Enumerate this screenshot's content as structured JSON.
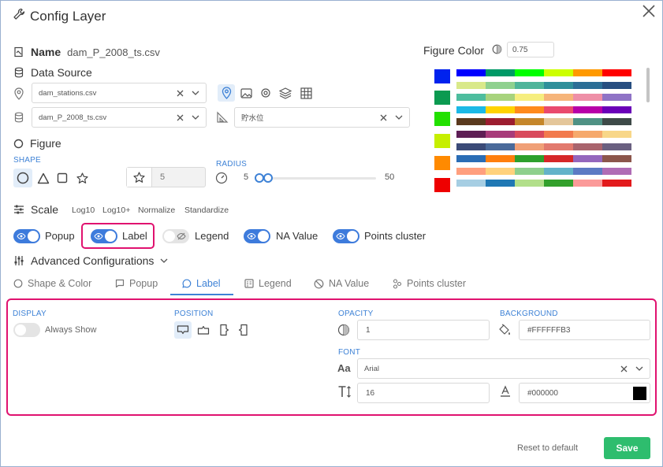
{
  "window": {
    "title": "Config Layer"
  },
  "name": {
    "label": "Name",
    "value": "dam_P_2008_ts.csv"
  },
  "data_source": {
    "label": "Data Source",
    "location_select": "dam_stations.csv",
    "data_select": "dam_P_2008_ts.csv",
    "column_select": "貯水位"
  },
  "figure": {
    "label": "Figure",
    "shape_label": "SHAPE",
    "size_value": "5",
    "radius_label": "RADIUS",
    "radius_min": "5",
    "radius_max": "50"
  },
  "figure_color": {
    "label": "Figure Color",
    "opacity": "0.75",
    "swatches": [
      "#0022ee",
      "#0b9a50",
      "#22e000",
      "#c6ef00",
      "#ff8a00",
      "#ee0000"
    ],
    "palettes": [
      [
        "#0000ff",
        "#009966",
        "#00ff00",
        "#ccff00",
        "#ff9900",
        "#ff0000"
      ],
      [
        "#d9e98a",
        "#8fd18f",
        "#4fb59a",
        "#2f8f9a",
        "#2b6e96",
        "#274e80"
      ],
      [
        "#4dbd9e",
        "#a7d37d",
        "#f6ee7f",
        "#f6b57a",
        "#ee8fa7",
        "#8f73c6"
      ],
      [
        "#1bb9e6",
        "#ffd300",
        "#ff8a1c",
        "#e94a6e",
        "#b700a8",
        "#6a00b8"
      ],
      [
        "#5a3a1e",
        "#9c1d2f",
        "#c5862a",
        "#e4c69a",
        "#4f9184",
        "#3e4a48"
      ],
      [
        "#5e1f55",
        "#a83b7a",
        "#d94a5c",
        "#f27a4d",
        "#f6a96c",
        "#f8d789"
      ],
      [
        "#3b4b78",
        "#4a6a9a",
        "#f0a077",
        "#e27a6e",
        "#a9646d",
        "#6a6080"
      ],
      [
        "#2a6db5",
        "#ff7f0e",
        "#2ca02c",
        "#d62728",
        "#9467bd",
        "#8c564b"
      ],
      [
        "#ff9f7e",
        "#ffd27d",
        "#8ed08d",
        "#63b3c9",
        "#5c7bc4",
        "#b06cb5"
      ],
      [
        "#a6cee3",
        "#1f78b4",
        "#b2df8a",
        "#33a02c",
        "#fb9a99",
        "#e31a1c"
      ]
    ]
  },
  "scale": {
    "label": "Scale",
    "options": [
      "Log10",
      "Log10+",
      "Normalize",
      "Standardize"
    ]
  },
  "toggles": {
    "popup": "Popup",
    "label": "Label",
    "legend": "Legend",
    "na_value": "NA Value",
    "points_cluster": "Points cluster"
  },
  "advanced": {
    "label": "Advanced Configurations",
    "tabs": [
      "Shape & Color",
      "Popup",
      "Label",
      "Legend",
      "NA Value",
      "Points cluster"
    ],
    "active_tab": "Label"
  },
  "label_panel": {
    "display_label": "DISPLAY",
    "always_show": "Always Show",
    "position_label": "POSITION",
    "opacity_label": "OPACITY",
    "opacity_value": "1",
    "background_label": "BACKGROUND",
    "background_value": "#FFFFFFB3",
    "font_label": "FONT",
    "font_family": "Arial",
    "font_size": "16",
    "font_color": "#000000"
  },
  "footer": {
    "reset": "Reset to default",
    "save": "Save"
  },
  "colors": {
    "accent": "#3e82d6",
    "highlight": "#e0126f",
    "save": "#2ebd6e"
  }
}
